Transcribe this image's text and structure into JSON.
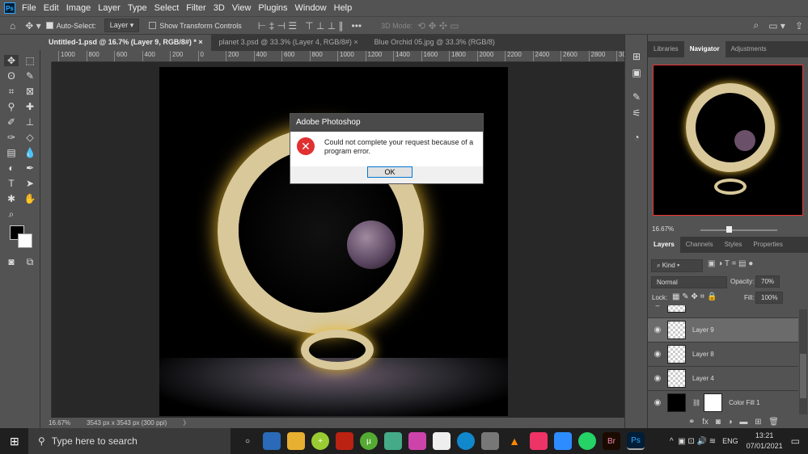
{
  "menu": {
    "logo": "Ps",
    "items": [
      "File",
      "Edit",
      "Image",
      "Layer",
      "Type",
      "Select",
      "Filter",
      "3D",
      "View",
      "Plugins",
      "Window",
      "Help"
    ]
  },
  "options": {
    "auto_select_label": "Auto-Select:",
    "auto_select_checked": true,
    "auto_select_target": "Layer",
    "show_transform_label": "Show Transform Controls",
    "mode_3d": "3D Mode:"
  },
  "tabs": [
    {
      "label": "Untitled-1.psd @ 16.7% (Layer 9, RGB/8#) *",
      "active": true
    },
    {
      "label": "planet 3.psd @ 33.3% (Layer 4, RGB/8#)",
      "active": false
    },
    {
      "label": "Blue Orchid 05.jpg @ 33.3% (RGB/8)",
      "active": false
    }
  ],
  "ruler": [
    "1000",
    "800",
    "600",
    "400",
    "200",
    "0",
    "200",
    "400",
    "600",
    "800",
    "1000",
    "1200",
    "1400",
    "1600",
    "1800",
    "2000",
    "2200",
    "2400",
    "2600",
    "2800",
    "3000",
    "3200",
    "3400",
    "3600",
    "3800",
    "4000",
    "4200",
    "4400"
  ],
  "status": {
    "zoom": "16.67%",
    "doc_size": "3543 px x 3543 px (300 ppi)",
    "arrow": "〉"
  },
  "dialog": {
    "title": "Adobe Photoshop",
    "message": "Could not complete your request because of a program error.",
    "ok": "OK"
  },
  "panel": {
    "top_tabs": [
      "Libraries",
      "Navigator",
      "Adjustments"
    ],
    "nav_zoom": "16.67%",
    "layer_tabs": [
      "Layers",
      "Channels",
      "Styles",
      "Properties"
    ],
    "kind": "Kind",
    "blend_mode": "Normal",
    "opacity_label": "Opacity:",
    "opacity": "70%",
    "lock_label": "Lock:",
    "fill_label": "Fill:",
    "fill": "100%",
    "layers": [
      {
        "name": "Layer 9",
        "selected": true
      },
      {
        "name": "Layer 8",
        "selected": false
      },
      {
        "name": "Layer 4",
        "selected": false
      },
      {
        "name": "Color Fill 1",
        "selected": false
      }
    ]
  },
  "taskbar": {
    "search_placeholder": "Type here to search",
    "lang": "ENG",
    "time": "13:21",
    "date": "07/01/2021",
    "pinned": [
      "Br",
      "Ps"
    ]
  },
  "colors": {
    "accent": "#31a8ff",
    "error": "#e03030",
    "selected_layer": "#6b6b6b"
  }
}
